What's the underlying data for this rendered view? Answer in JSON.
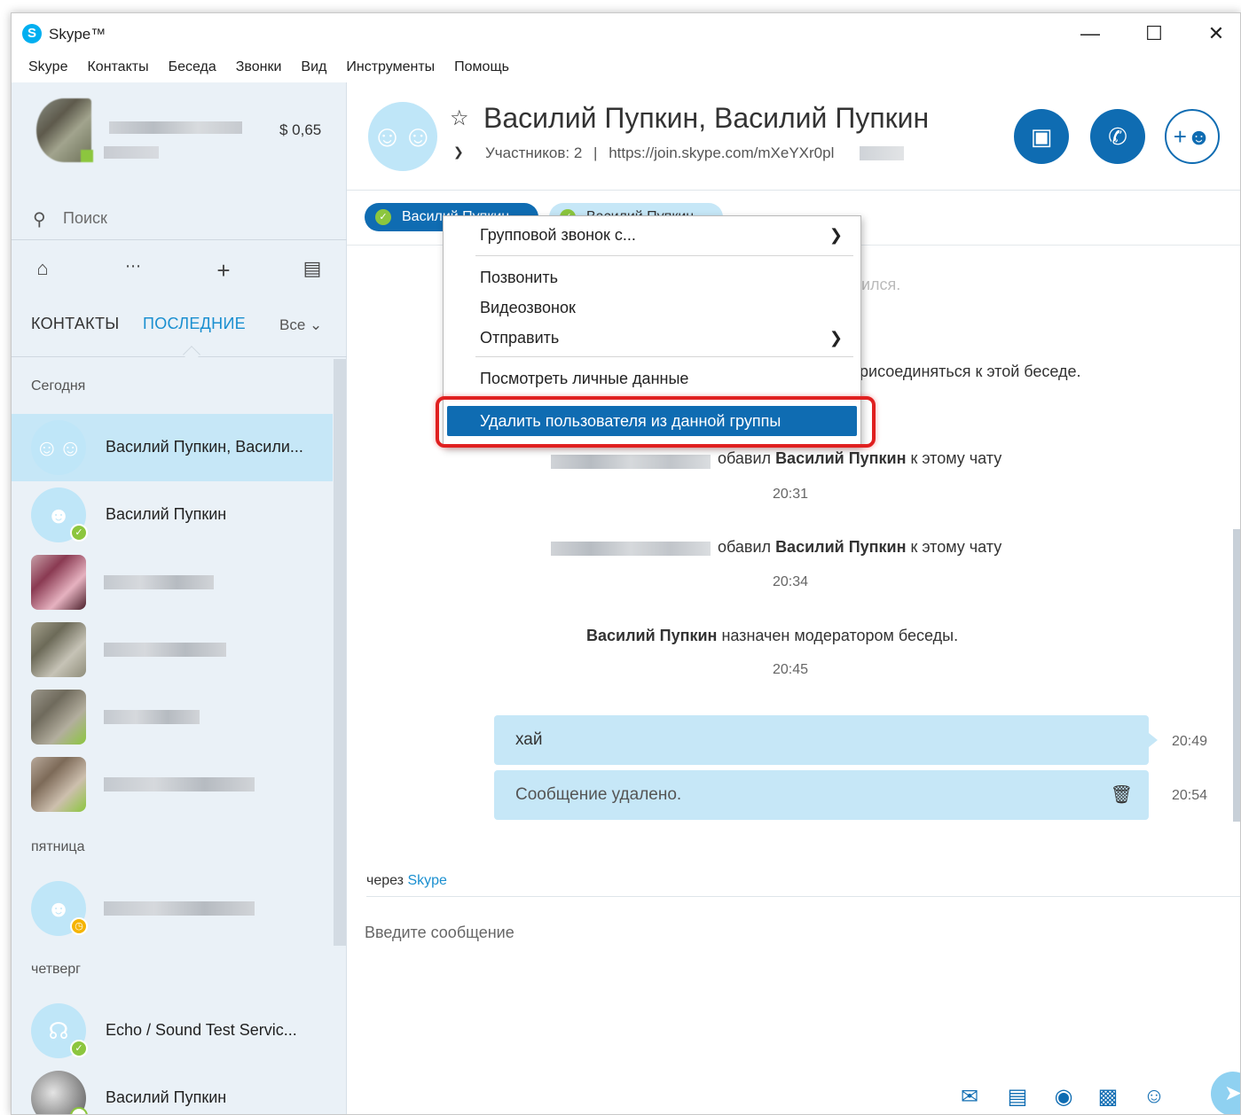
{
  "window": {
    "title": "Skype™",
    "minimize": "—",
    "maximize": "☐",
    "close": "✕"
  },
  "menubar": [
    "Skype",
    "Контакты",
    "Беседа",
    "Звонки",
    "Вид",
    "Инструменты",
    "Помощь"
  ],
  "profile": {
    "balance": "$ 0,65"
  },
  "search": {
    "placeholder": "Поиск"
  },
  "nav_icons": [
    "home-icon",
    "dialpad-icon",
    "plus-icon",
    "contacts-book-icon"
  ],
  "tabs": {
    "contacts": "КОНТАКТЫ",
    "recent": "ПОСЛЕДНИЕ",
    "filter": "Все ⌄"
  },
  "conversations": {
    "today_label": "Сегодня",
    "friday_label": "пятница",
    "thursday_label": "четверг",
    "items": [
      {
        "name": "Василий Пупкин, Васили...",
        "avatar": "group-icon"
      },
      {
        "name": "Василий Пупкин",
        "avatar": "user-icon",
        "status": "online"
      },
      {
        "name": "Echo / Sound Test Servic...",
        "avatar": "headset-icon",
        "status": "online"
      },
      {
        "name": "Василий Пупкин",
        "avatar": "photo",
        "status": "offline"
      }
    ]
  },
  "chat": {
    "title": "Василий Пупкин, Василий Пупкин",
    "participants": "Участников: 2",
    "separator": "|",
    "link": "https://join.skype.com/mXeYXr0pl",
    "chip_1": "Василий Пупкин",
    "chip_2": "Василий Пупкин"
  },
  "messages": {
    "joined_suffix": "ился.",
    "invite_text": "рисоединяться к этой беседе.",
    "added_1_prefix": "обавил",
    "added_1_name": "Василий Пупкин",
    "added_1_suffix": "к этому чату",
    "time_1": "20:31",
    "added_2_prefix": "обавил",
    "added_2_name": "Василий Пупкин",
    "added_2_suffix": "к этому чату",
    "time_2": "20:34",
    "moderator_name": "Василий Пупкин",
    "moderator_text": "назначен модератором беседы.",
    "time_3": "20:45",
    "bubble_1": "хай",
    "bubble_1_time": "20:49",
    "bubble_2": "Сообщение удалено.",
    "bubble_2_time": "20:54"
  },
  "composer": {
    "via_prefix": "через",
    "via_link": "Skype",
    "placeholder": "Введите сообщение"
  },
  "toolbar_icons": [
    "contacts-send-icon",
    "file-icon",
    "video-message-icon",
    "contact-card-icon",
    "emoticon-icon",
    "send-icon"
  ],
  "context_menu": {
    "group_call": "Групповой звонок с...",
    "call": "Позвонить",
    "video_call": "Видеозвонок",
    "send": "Отправить",
    "view_profile": "Посмотреть личные данные",
    "remove_user": "Удалить пользователя из данной группы"
  },
  "colors": {
    "accent": "#0f6cb2",
    "highlight": "#e02020",
    "bubble": "#c6e7f7",
    "sidebar": "#eaf1f7",
    "online": "#8cc63e"
  }
}
